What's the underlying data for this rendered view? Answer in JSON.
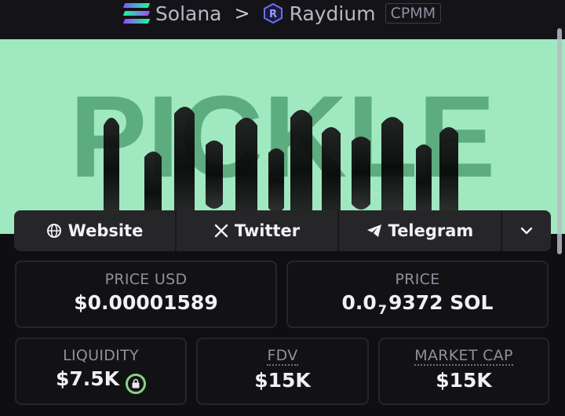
{
  "breadcrumb": {
    "chain": "Solana",
    "separator": ">",
    "dex": "Raydium",
    "pool_type": "CPMM"
  },
  "banner": {
    "text": "PICKLE",
    "background_color": "#9fe8c0"
  },
  "links": {
    "website": "Website",
    "twitter": "Twitter",
    "telegram": "Telegram"
  },
  "stats": {
    "price_usd_label": "PRICE USD",
    "price_usd_value": "$0.00001589",
    "price_label": "PRICE",
    "price_value_lead": "0.0",
    "price_value_zeros": "7",
    "price_value_tail": "9372 SOL",
    "liquidity_label": "LIQUIDITY",
    "liquidity_value": "$7.5K",
    "fdv_label": "FDV",
    "fdv_value": "$15K",
    "market_cap_label": "MARKET CAP",
    "market_cap_value": "$15K"
  },
  "colors": {
    "accent_green": "#8bd18b",
    "card_bg": "#121215"
  }
}
